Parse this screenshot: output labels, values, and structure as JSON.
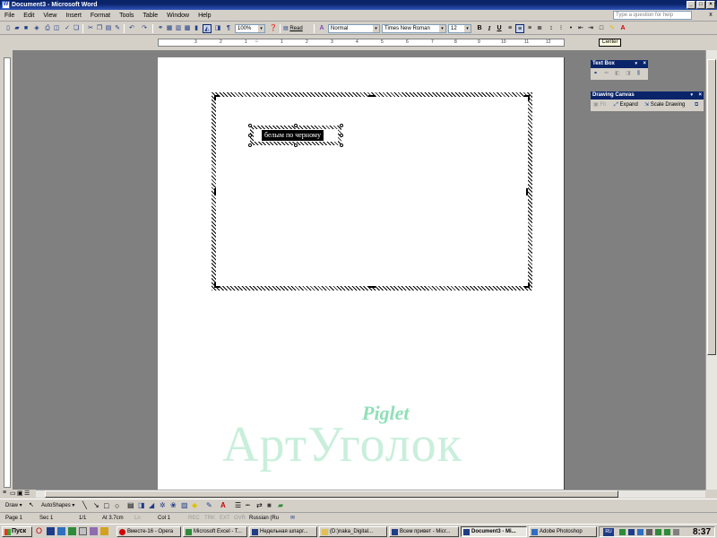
{
  "window": {
    "title": "Document3 - Microsoft Word",
    "app_icon": "W"
  },
  "menu": {
    "items": [
      "File",
      "Edit",
      "View",
      "Insert",
      "Format",
      "Tools",
      "Table",
      "Window",
      "Help"
    ],
    "help_placeholder": "Type a question for help",
    "close_glyph": "x"
  },
  "toolbar": {
    "zoom": "100%",
    "read_label": "Read",
    "style": "Normal",
    "font": "Times New Roman",
    "size": "12",
    "bold": "B",
    "italic": "I",
    "underline": "U",
    "pilcrow": "¶",
    "tooltip": "Center"
  },
  "ruler": {
    "ticks": [
      "3",
      "2",
      "1",
      "1",
      "2",
      "3",
      "4",
      "5",
      "6",
      "7",
      "8",
      "9",
      "10",
      "11",
      "12",
      "13",
      "14",
      "15"
    ]
  },
  "panels": {
    "text_box": {
      "title": "Text Box"
    },
    "drawing_canvas": {
      "title": "Drawing Canvas",
      "fit_label": "Fit",
      "expand_label": "Expand",
      "scale_label": "Scale Drawing"
    }
  },
  "document": {
    "textbox_text": "белым по черному"
  },
  "watermark": {
    "line1": "Piglet",
    "line2": "АртУголок"
  },
  "drawbar": {
    "draw_label": "Draw ▾",
    "autoshapes_label": "AutoShapes ▾"
  },
  "status": {
    "page": "Page 1",
    "sec": "Sec 1",
    "of": "1/1",
    "at": "At 3.7cm",
    "ln": "Ln",
    "col": "Col 1",
    "rec": "REC",
    "trk": "TRK",
    "ext": "EXT",
    "ovr": "OVR",
    "lang": "Russian (Ru"
  },
  "taskbar": {
    "start_label": "Пуск",
    "tasks": [
      "Вместе-16 - Opera",
      "Microsoft Excel - T...",
      "Недельная шпарг...",
      "(D:)naka_Digital...",
      "Всем привет - Micr...",
      "Document3 - Mi...",
      "Adobe Photoshop"
    ],
    "lang_indicator": "RU",
    "clock": "8:37"
  },
  "colors": {
    "title_bar": "#0A246A",
    "workspace": "#808080",
    "watermark": "#8fe0b8"
  }
}
